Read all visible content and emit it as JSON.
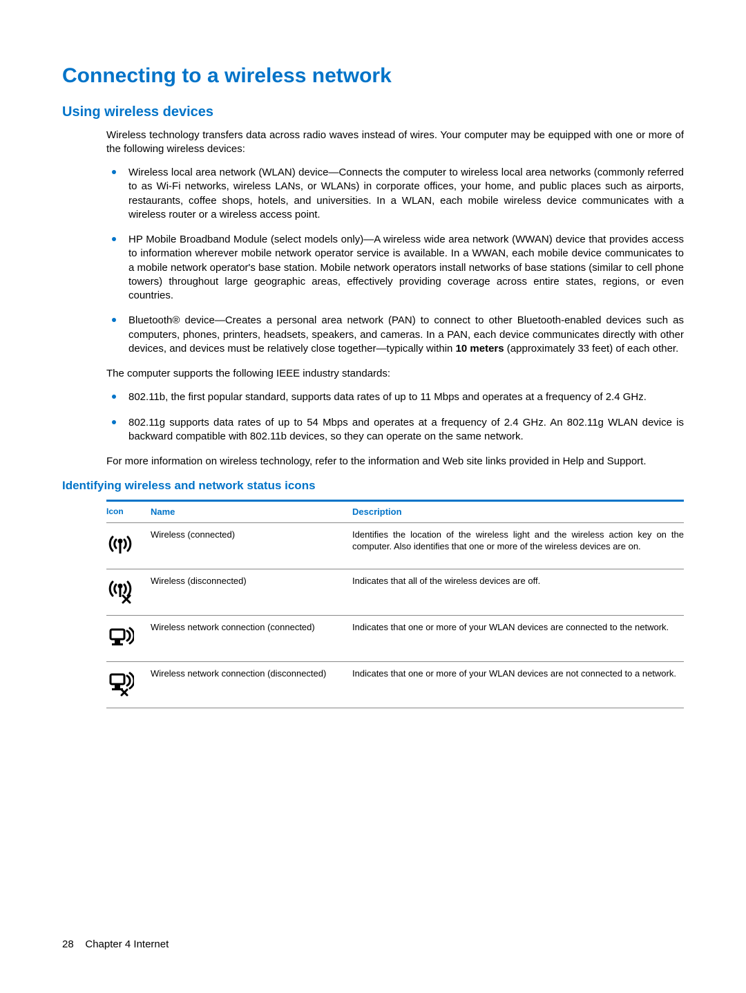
{
  "h1": "Connecting to a wireless network",
  "h2": "Using wireless devices",
  "intro": "Wireless technology transfers data across radio waves instead of wires. Your computer may be equipped with one or more of the following wireless devices:",
  "devices": [
    "Wireless local area network (WLAN) device—Connects the computer to wireless local area networks (commonly referred to as Wi-Fi networks, wireless LANs, or WLANs) in corporate offices, your home, and public places such as airports, restaurants, coffee shops, hotels, and universities. In a WLAN, each mobile wireless device communicates with a wireless router or a wireless access point.",
    "HP Mobile Broadband Module (select models only)—A wireless wide area network (WWAN) device that provides access to information wherever mobile network operator service is available. In a WWAN, each mobile device communicates to a mobile network operator's base station. Mobile network operators install networks of base stations (similar to cell phone towers) throughout large geographic areas, effectively providing coverage across entire states, regions, or even countries.",
    "Bluetooth® device—Creates a personal area network (PAN) to connect to other Bluetooth-enabled devices such as computers, phones, printers, headsets, speakers, and cameras. In a PAN, each device communicates directly with other devices, and devices must be relatively close together—typically within 10 meters (approximately 33 feet) of each other."
  ],
  "device3_pre": "Bluetooth® device—Creates a personal area network (PAN) to connect to other Bluetooth-enabled devices such as computers, phones, printers, headsets, speakers, and cameras. In a PAN, each device communicates directly with other devices, and devices must be relatively close together—typically within ",
  "device3_bold": "10 meters",
  "device3_post": " (approximately 33 feet) of each other.",
  "standards_intro": "The computer supports the following IEEE industry standards:",
  "standards": [
    "802.11b, the first popular standard, supports data rates of up to 11 Mbps and operates at a frequency of 2.4 GHz.",
    "802.11g supports data rates of up to 54 Mbps and operates at a frequency of 2.4 GHz. An 802.11g WLAN device is backward compatible with 802.11b devices, so they can operate on the same network."
  ],
  "more_info": "For more information on wireless technology, refer to the information and Web site links provided in Help and Support.",
  "h3": "Identifying wireless and network status icons",
  "table": {
    "headers": {
      "icon": "Icon",
      "name": "Name",
      "description": "Description"
    },
    "rows": [
      {
        "icon": "wireless-on-icon",
        "name": "Wireless (connected)",
        "description": "Identifies the location of the wireless light and the wireless action key on the computer. Also identifies that one or more of the wireless devices are on."
      },
      {
        "icon": "wireless-off-icon",
        "name": "Wireless (disconnected)",
        "description": "Indicates that all of the wireless devices are off."
      },
      {
        "icon": "wlan-connected-icon",
        "name": "Wireless network connection (connected)",
        "description": "Indicates that one or more of your WLAN devices are connected to the network."
      },
      {
        "icon": "wlan-disconnected-icon",
        "name": "Wireless network connection (disconnected)",
        "description": "Indicates that one or more of your WLAN devices are not connected to a network."
      }
    ]
  },
  "footer": {
    "page": "28",
    "chapter": "Chapter 4   Internet"
  }
}
